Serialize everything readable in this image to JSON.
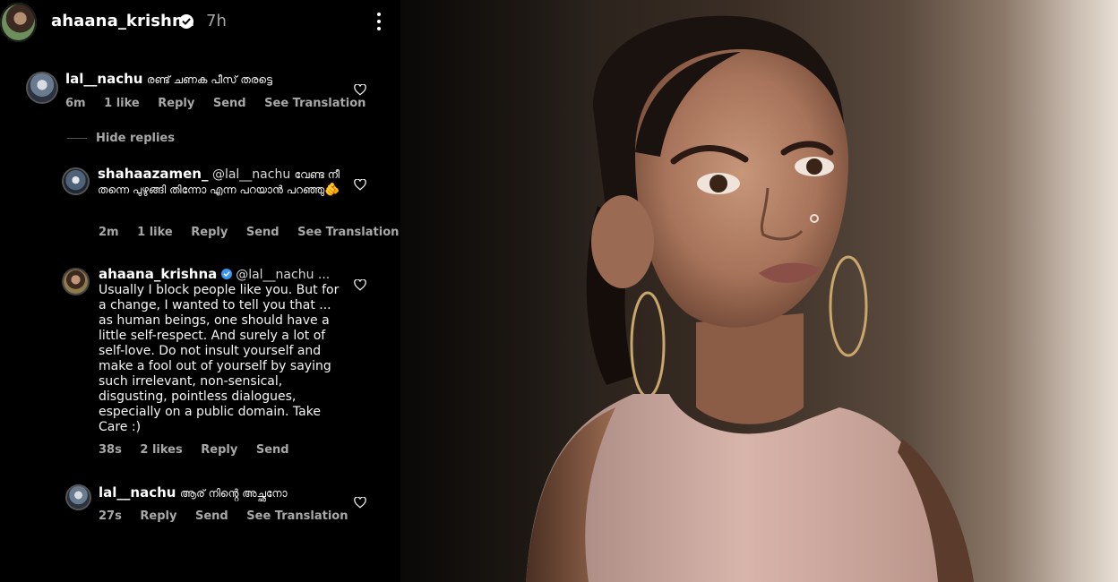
{
  "header": {
    "username": "ahaana_krishna",
    "time": "7h"
  },
  "comments": [
    {
      "username": "lal__nachu",
      "text": "രണ്ട് ചണക പീസ് തരട്ടെ",
      "time": "6m",
      "likes": "1 like",
      "reply": "Reply",
      "send": "Send",
      "translation": "See Translation"
    },
    {
      "username": "shahaazamen_",
      "mention": "@lal__nachu",
      "text": "വേണ്ട നീ തന്നെ പുഴുങ്ങി തിന്നോ എന്ന പറയാൻ പറഞ്ഞു",
      "emoji": "🫵",
      "time": "2m",
      "likes": "1 like",
      "reply": "Reply",
      "send": "Send",
      "translation": "See Translation"
    },
    {
      "username": "ahaana_krishna",
      "mention": "@lal__nachu ...",
      "text": "Usually I block people like you. But for a change, I wanted to tell you that ... as human beings, one should have a little self-respect. And surely a lot of self-love. Do not insult yourself and make a fool out of yourself by saying such irrelevant, non-sensical, disgusting, pointless dialogues, especially on a public domain. Take Care :)",
      "time": "38s",
      "likes": "2 likes",
      "reply": "Reply",
      "send": "Send"
    },
    {
      "username": "lal__nachu",
      "text": "ആര് നിൻ്റെ അച്ഛനോ",
      "time": "27s",
      "reply": "Reply",
      "send": "Send",
      "translation": "See Translation"
    }
  ],
  "hide_replies": "Hide replies",
  "colors": {
    "background": "#000000",
    "text": "#ffffff",
    "muted": "#a8a8a8",
    "verified": "#3897f0"
  }
}
